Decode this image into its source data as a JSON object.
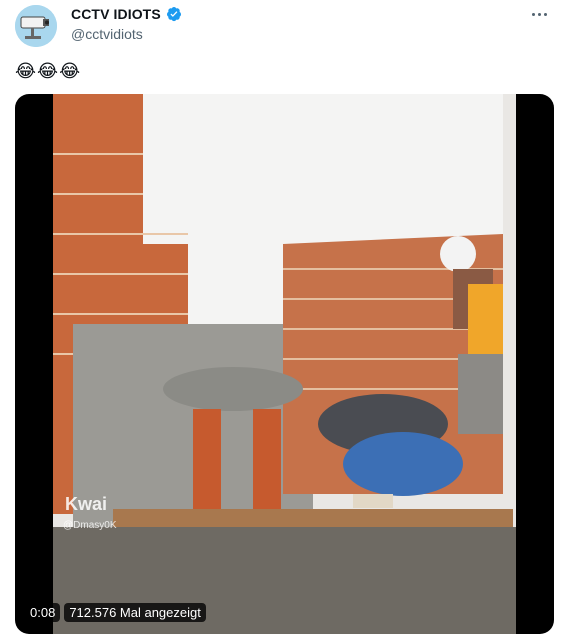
{
  "account": {
    "display_name": "CCTV IDIOTS",
    "handle": "@cctvidiots",
    "verified": true
  },
  "tweet": {
    "text": "😂😂😂"
  },
  "media": {
    "watermark_brand": "Kwai",
    "watermark_user": "@Dmasy0K",
    "timestamp": "0:08",
    "view_count": "712.576 Mal angezeigt"
  },
  "icons": {
    "avatar": "cctv-camera-icon",
    "verified": "verified-badge-icon",
    "more": "more-options-icon"
  },
  "colors": {
    "verified_blue": "#1d9bf0",
    "secondary_text": "#536471",
    "brick": "#c8683c"
  }
}
